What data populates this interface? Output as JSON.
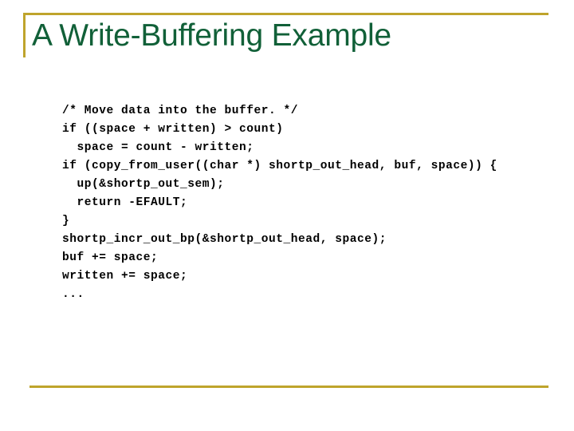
{
  "slide": {
    "title": "A Write-Buffering Example",
    "accent_color": "#BFA42C",
    "title_color": "#116038",
    "background_color": "#FFFFFF",
    "code_color": "#000000",
    "code_lines": [
      "/* Move data into the buffer. */",
      "if ((space + written) > count)",
      "  space = count - written;",
      "if (copy_from_user((char *) shortp_out_head, buf, space)) {",
      "  up(&shortp_out_sem);",
      "  return -EFAULT;",
      "}",
      "shortp_incr_out_bp(&shortp_out_head, space);",
      "buf += space;",
      "written += space;",
      "..."
    ]
  }
}
